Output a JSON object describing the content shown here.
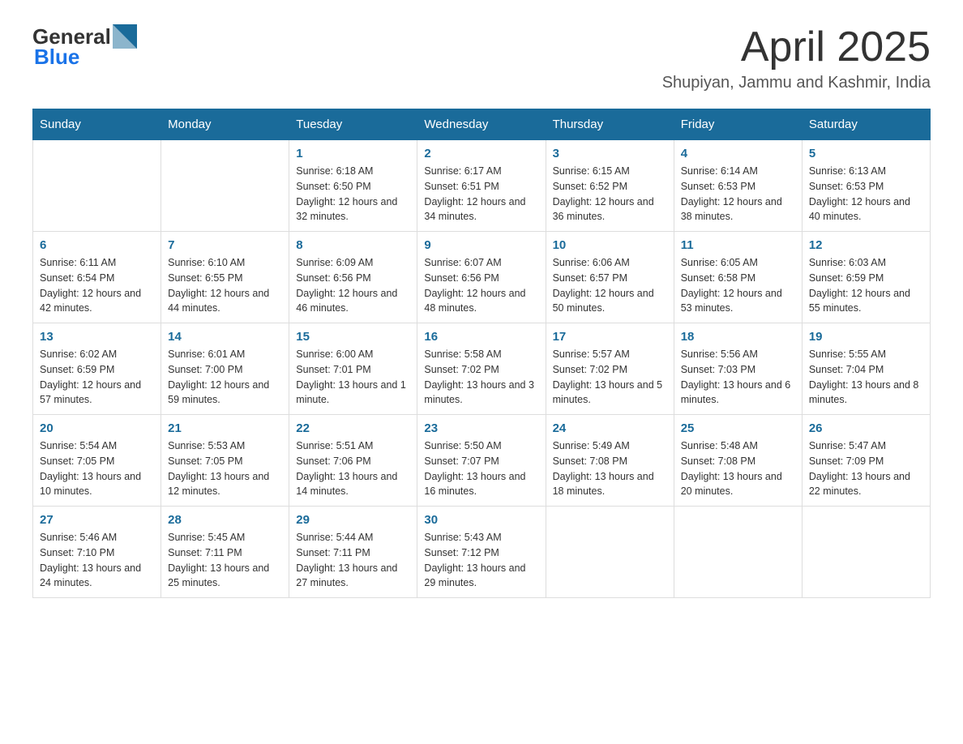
{
  "header": {
    "logo_general": "General",
    "logo_blue": "Blue",
    "title": "April 2025",
    "subtitle": "Shupiyan, Jammu and Kashmir, India"
  },
  "days_of_week": [
    "Sunday",
    "Monday",
    "Tuesday",
    "Wednesday",
    "Thursday",
    "Friday",
    "Saturday"
  ],
  "weeks": [
    [
      {
        "day": "",
        "info": ""
      },
      {
        "day": "",
        "info": ""
      },
      {
        "day": "1",
        "sunrise": "6:18 AM",
        "sunset": "6:50 PM",
        "daylight": "12 hours and 32 minutes."
      },
      {
        "day": "2",
        "sunrise": "6:17 AM",
        "sunset": "6:51 PM",
        "daylight": "12 hours and 34 minutes."
      },
      {
        "day": "3",
        "sunrise": "6:15 AM",
        "sunset": "6:52 PM",
        "daylight": "12 hours and 36 minutes."
      },
      {
        "day": "4",
        "sunrise": "6:14 AM",
        "sunset": "6:53 PM",
        "daylight": "12 hours and 38 minutes."
      },
      {
        "day": "5",
        "sunrise": "6:13 AM",
        "sunset": "6:53 PM",
        "daylight": "12 hours and 40 minutes."
      }
    ],
    [
      {
        "day": "6",
        "sunrise": "6:11 AM",
        "sunset": "6:54 PM",
        "daylight": "12 hours and 42 minutes."
      },
      {
        "day": "7",
        "sunrise": "6:10 AM",
        "sunset": "6:55 PM",
        "daylight": "12 hours and 44 minutes."
      },
      {
        "day": "8",
        "sunrise": "6:09 AM",
        "sunset": "6:56 PM",
        "daylight": "12 hours and 46 minutes."
      },
      {
        "day": "9",
        "sunrise": "6:07 AM",
        "sunset": "6:56 PM",
        "daylight": "12 hours and 48 minutes."
      },
      {
        "day": "10",
        "sunrise": "6:06 AM",
        "sunset": "6:57 PM",
        "daylight": "12 hours and 50 minutes."
      },
      {
        "day": "11",
        "sunrise": "6:05 AM",
        "sunset": "6:58 PM",
        "daylight": "12 hours and 53 minutes."
      },
      {
        "day": "12",
        "sunrise": "6:03 AM",
        "sunset": "6:59 PM",
        "daylight": "12 hours and 55 minutes."
      }
    ],
    [
      {
        "day": "13",
        "sunrise": "6:02 AM",
        "sunset": "6:59 PM",
        "daylight": "12 hours and 57 minutes."
      },
      {
        "day": "14",
        "sunrise": "6:01 AM",
        "sunset": "7:00 PM",
        "daylight": "12 hours and 59 minutes."
      },
      {
        "day": "15",
        "sunrise": "6:00 AM",
        "sunset": "7:01 PM",
        "daylight": "13 hours and 1 minute."
      },
      {
        "day": "16",
        "sunrise": "5:58 AM",
        "sunset": "7:02 PM",
        "daylight": "13 hours and 3 minutes."
      },
      {
        "day": "17",
        "sunrise": "5:57 AM",
        "sunset": "7:02 PM",
        "daylight": "13 hours and 5 minutes."
      },
      {
        "day": "18",
        "sunrise": "5:56 AM",
        "sunset": "7:03 PM",
        "daylight": "13 hours and 6 minutes."
      },
      {
        "day": "19",
        "sunrise": "5:55 AM",
        "sunset": "7:04 PM",
        "daylight": "13 hours and 8 minutes."
      }
    ],
    [
      {
        "day": "20",
        "sunrise": "5:54 AM",
        "sunset": "7:05 PM",
        "daylight": "13 hours and 10 minutes."
      },
      {
        "day": "21",
        "sunrise": "5:53 AM",
        "sunset": "7:05 PM",
        "daylight": "13 hours and 12 minutes."
      },
      {
        "day": "22",
        "sunrise": "5:51 AM",
        "sunset": "7:06 PM",
        "daylight": "13 hours and 14 minutes."
      },
      {
        "day": "23",
        "sunrise": "5:50 AM",
        "sunset": "7:07 PM",
        "daylight": "13 hours and 16 minutes."
      },
      {
        "day": "24",
        "sunrise": "5:49 AM",
        "sunset": "7:08 PM",
        "daylight": "13 hours and 18 minutes."
      },
      {
        "day": "25",
        "sunrise": "5:48 AM",
        "sunset": "7:08 PM",
        "daylight": "13 hours and 20 minutes."
      },
      {
        "day": "26",
        "sunrise": "5:47 AM",
        "sunset": "7:09 PM",
        "daylight": "13 hours and 22 minutes."
      }
    ],
    [
      {
        "day": "27",
        "sunrise": "5:46 AM",
        "sunset": "7:10 PM",
        "daylight": "13 hours and 24 minutes."
      },
      {
        "day": "28",
        "sunrise": "5:45 AM",
        "sunset": "7:11 PM",
        "daylight": "13 hours and 25 minutes."
      },
      {
        "day": "29",
        "sunrise": "5:44 AM",
        "sunset": "7:11 PM",
        "daylight": "13 hours and 27 minutes."
      },
      {
        "day": "30",
        "sunrise": "5:43 AM",
        "sunset": "7:12 PM",
        "daylight": "13 hours and 29 minutes."
      },
      {
        "day": "",
        "info": ""
      },
      {
        "day": "",
        "info": ""
      },
      {
        "day": "",
        "info": ""
      }
    ]
  ]
}
